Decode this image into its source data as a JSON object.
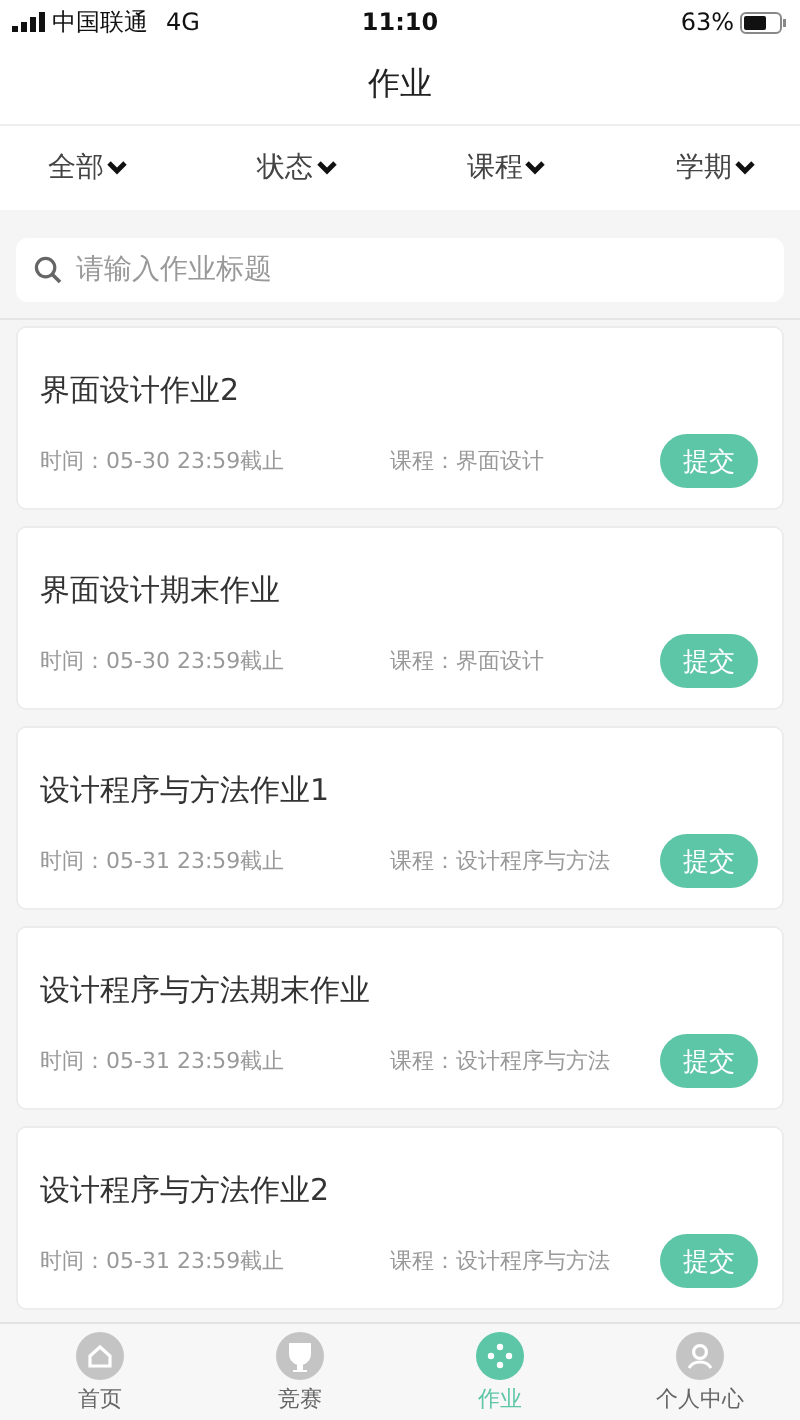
{
  "status_bar": {
    "carrier": "中国联通",
    "network": "4G",
    "time": "11:10",
    "battery": "63%"
  },
  "title": "作业",
  "filters": [
    {
      "label": "全部"
    },
    {
      "label": "状态"
    },
    {
      "label": "课程"
    },
    {
      "label": "学期"
    }
  ],
  "search": {
    "placeholder": "请输入作业标题"
  },
  "assignments": [
    {
      "title": "界面设计作业2",
      "time": "时间：05-30 23:59截止",
      "course": "课程：界面设计",
      "action": "提交"
    },
    {
      "title": "界面设计期末作业",
      "time": "时间：05-30 23:59截止",
      "course": "课程：界面设计",
      "action": "提交"
    },
    {
      "title": "设计程序与方法作业1",
      "time": "时间：05-31 23:59截止",
      "course": "课程：设计程序与方法",
      "action": "提交"
    },
    {
      "title": "设计程序与方法期末作业",
      "time": "时间：05-31 23:59截止",
      "course": "课程：设计程序与方法",
      "action": "提交"
    },
    {
      "title": "设计程序与方法作业2",
      "time": "时间：05-31 23:59截止",
      "course": "课程：设计程序与方法",
      "action": "提交"
    }
  ],
  "tab_bar": [
    {
      "label": "首页",
      "kind": "home",
      "selected": false
    },
    {
      "label": "竞赛",
      "kind": "trophy",
      "selected": false
    },
    {
      "label": "作业",
      "kind": "assignment",
      "selected": true
    },
    {
      "label": "个人中心",
      "kind": "person",
      "selected": false
    }
  ]
}
